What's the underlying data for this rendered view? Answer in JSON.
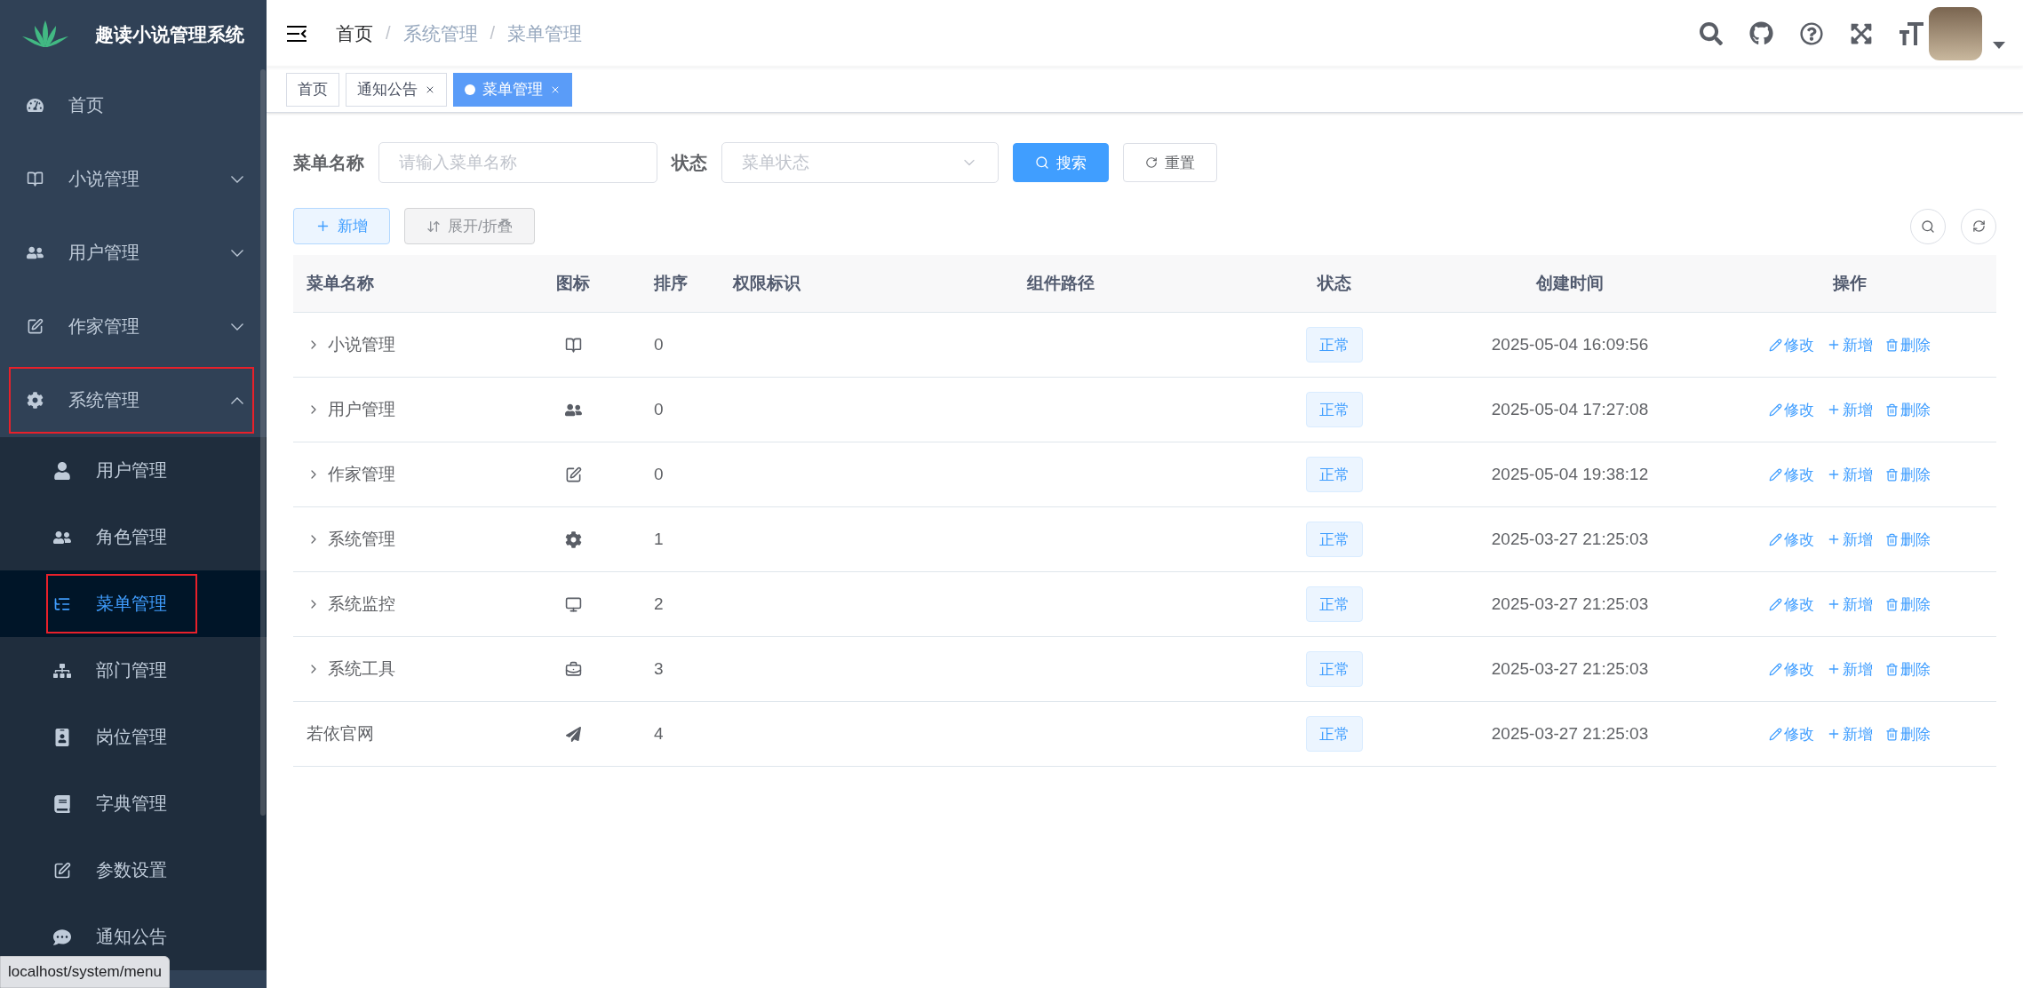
{
  "sidebar": {
    "title": "趣读小说管理系统",
    "items": [
      {
        "label": "首页",
        "kind": "dashboard",
        "selected": false,
        "highlighted": false
      },
      {
        "label": "小说管理",
        "kind": "book",
        "expanded": false,
        "selected": false,
        "highlighted": false
      },
      {
        "label": "用户管理",
        "kind": "users",
        "expanded": false,
        "selected": false,
        "highlighted": false
      },
      {
        "label": "作家管理",
        "kind": "edit",
        "expanded": false,
        "selected": false,
        "highlighted": false
      },
      {
        "label": "系统管理",
        "kind": "gear",
        "expanded": true,
        "selected": false,
        "highlighted": true,
        "children": [
          {
            "label": "用户管理",
            "kind": "user",
            "selected": false,
            "highlighted": false
          },
          {
            "label": "角色管理",
            "kind": "users",
            "selected": false,
            "highlighted": false
          },
          {
            "label": "菜单管理",
            "kind": "tree",
            "selected": true,
            "highlighted": true
          },
          {
            "label": "部门管理",
            "kind": "sitemap",
            "selected": false,
            "highlighted": false
          },
          {
            "label": "岗位管理",
            "kind": "badge",
            "selected": false,
            "highlighted": false
          },
          {
            "label": "字典管理",
            "kind": "dict",
            "selected": false,
            "highlighted": false
          },
          {
            "label": "参数设置",
            "kind": "edit",
            "selected": false,
            "highlighted": false
          },
          {
            "label": "通知公告",
            "kind": "message",
            "selected": false,
            "highlighted": false
          }
        ]
      }
    ]
  },
  "breadcrumb": {
    "separator": "/",
    "items": [
      "首页",
      "系统管理",
      "菜单管理"
    ]
  },
  "tabs": [
    {
      "label": "首页",
      "selected": false,
      "closable": false
    },
    {
      "label": "通知公告",
      "selected": false,
      "closable": true
    },
    {
      "label": "菜单管理",
      "selected": true,
      "closable": true
    }
  ],
  "search_form": {
    "fields": [
      {
        "kind": "input",
        "label": "菜单名称",
        "placeholder": "请输入菜单名称"
      },
      {
        "kind": "select",
        "label": "状态",
        "placeholder": "菜单状态"
      }
    ],
    "buttons": [
      {
        "kind": "search",
        "label": "搜索"
      },
      {
        "kind": "reset",
        "label": "重置"
      }
    ]
  },
  "toolbar": {
    "buttons": [
      {
        "kind": "add",
        "label": "新增"
      },
      {
        "kind": "expand",
        "label": "展开/折叠"
      }
    ]
  },
  "table": {
    "columns": [
      "菜单名称",
      "图标",
      "排序",
      "权限标识",
      "组件路径",
      "状态",
      "创建时间",
      "操作"
    ],
    "rows": [
      {
        "name": "小说管理",
        "expandable": true,
        "kind": "book",
        "order": "0",
        "status": "正常",
        "created": "2025-05-04 16:09:56",
        "actions": [
          {
            "kind": "edit",
            "label": "修改"
          },
          {
            "kind": "add",
            "label": "新增"
          },
          {
            "kind": "delete",
            "label": "删除"
          }
        ]
      },
      {
        "name": "用户管理",
        "expandable": true,
        "kind": "users",
        "order": "0",
        "status": "正常",
        "created": "2025-05-04 17:27:08",
        "actions": [
          {
            "kind": "edit",
            "label": "修改"
          },
          {
            "kind": "add",
            "label": "新增"
          },
          {
            "kind": "delete",
            "label": "删除"
          }
        ]
      },
      {
        "name": "作家管理",
        "expandable": true,
        "kind": "edit",
        "order": "0",
        "status": "正常",
        "created": "2025-05-04 19:38:12",
        "actions": [
          {
            "kind": "edit",
            "label": "修改"
          },
          {
            "kind": "add",
            "label": "新增"
          },
          {
            "kind": "delete",
            "label": "删除"
          }
        ]
      },
      {
        "name": "系统管理",
        "expandable": true,
        "kind": "gear",
        "order": "1",
        "status": "正常",
        "created": "2025-03-27 21:25:03",
        "actions": [
          {
            "kind": "edit",
            "label": "修改"
          },
          {
            "kind": "add",
            "label": "新增"
          },
          {
            "kind": "delete",
            "label": "删除"
          }
        ]
      },
      {
        "name": "系统监控",
        "expandable": true,
        "kind": "monitor",
        "order": "2",
        "status": "正常",
        "created": "2025-03-27 21:25:03",
        "actions": [
          {
            "kind": "edit",
            "label": "修改"
          },
          {
            "kind": "add",
            "label": "新增"
          },
          {
            "kind": "delete",
            "label": "删除"
          }
        ]
      },
      {
        "name": "系统工具",
        "expandable": true,
        "kind": "toolbox",
        "order": "3",
        "status": "正常",
        "created": "2025-03-27 21:25:03",
        "actions": [
          {
            "kind": "edit",
            "label": "修改"
          },
          {
            "kind": "add",
            "label": "新增"
          },
          {
            "kind": "delete",
            "label": "删除"
          }
        ]
      },
      {
        "name": "若依官网",
        "expandable": false,
        "kind": "send",
        "order": "4",
        "status": "正常",
        "created": "2025-03-27 21:25:03",
        "actions": [
          {
            "kind": "edit",
            "label": "修改"
          },
          {
            "kind": "add",
            "label": "新增"
          },
          {
            "kind": "delete",
            "label": "删除"
          }
        ]
      }
    ]
  },
  "status_bar": {
    "url": "localhost/system/menu"
  }
}
